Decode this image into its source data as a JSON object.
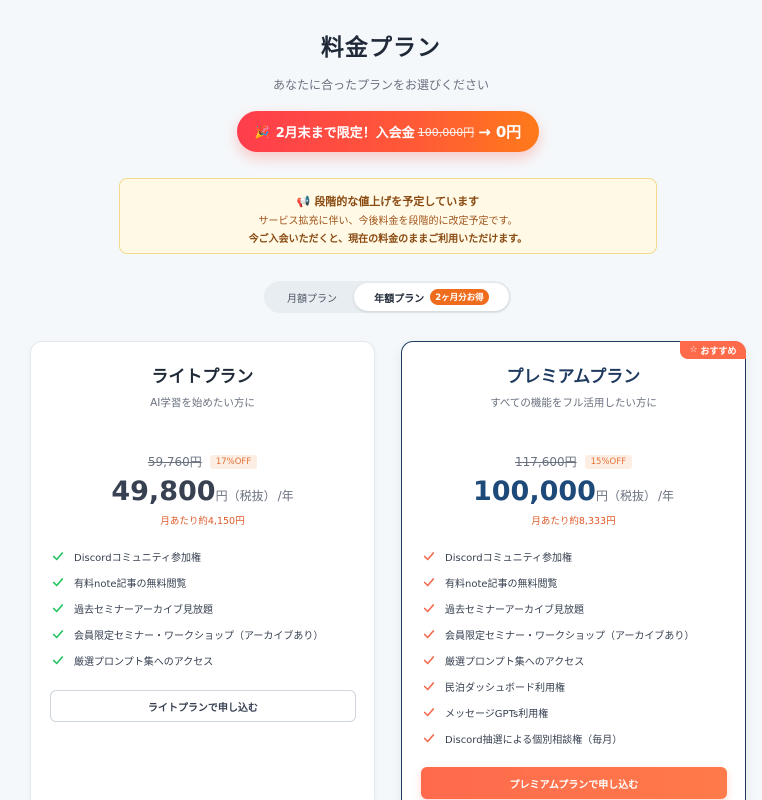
{
  "header": {
    "title": "料金プラン",
    "subtitle": "あなたに合ったプランをお選びください"
  },
  "promo": {
    "icon": "party-popper-icon",
    "label": "2月末まで限定！入会金",
    "original_fee": "100,000円",
    "arrow": "→",
    "new_fee": "0円"
  },
  "notice": {
    "icon": "megaphone-icon",
    "heading": "段階的な値上げを予定しています",
    "line1": "サービス拡充に伴い、今後料金を段階的に改定予定です。",
    "line2": "今ご入会いただくと、現在の料金のままご利用いただけます。"
  },
  "billing_toggle": {
    "monthly_label": "月額プラン",
    "yearly_label": "年額プラン",
    "yearly_badge": "2ヶ月分お得",
    "selected": "yearly"
  },
  "plans": {
    "lite": {
      "name": "ライトプラン",
      "description": "AI学習を始めたい方に",
      "original_price": "59,760円",
      "discount_badge": "17%OFF",
      "price": "49,800",
      "price_unit": "円（税抜）",
      "period": "/年",
      "monthly_note": "月あたり約4,150円",
      "features": [
        "Discordコミュニティ参加権",
        "有料note記事の無料閲覧",
        "過去セミナーアーカイブ見放題",
        "会員限定セミナー・ワークショップ（アーカイブあり）",
        "厳選プロンプト集へのアクセス"
      ],
      "cta": "ライトプランで申し込む",
      "check_color": "#22c55e"
    },
    "premium": {
      "recommended_badge": "おすすめ",
      "name": "プレミアムプラン",
      "description": "すべての機能をフル活用したい方に",
      "original_price": "117,600円",
      "discount_badge": "15%OFF",
      "price": "100,000",
      "price_unit": "円（税抜）",
      "period": "/年",
      "monthly_note": "月あたり約8,333円",
      "features": [
        "Discordコミュニティ参加権",
        "有料note記事の無料閲覧",
        "過去セミナーアーカイブ見放題",
        "会員限定セミナー・ワークショップ（アーカイブあり）",
        "厳選プロンプト集へのアクセス",
        "民泊ダッシュボード利用権",
        "メッセージGPTs利用権",
        "Discord抽選による個別相談権（毎月）"
      ],
      "cta": "プレミアムプランで申し込む",
      "check_color": "#f26b4f"
    }
  },
  "colors": {
    "accent": "#ff5a36",
    "navy": "#1e3a5f",
    "background": "#f5f8fb"
  }
}
